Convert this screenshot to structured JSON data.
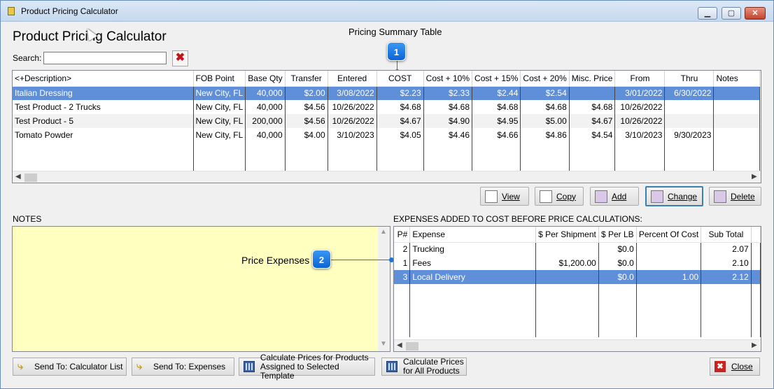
{
  "window": {
    "title": "Product Pricing Calculator",
    "heading": "Product Pricing Calculator",
    "minimize": "▁",
    "restore": "▢",
    "close": "✕"
  },
  "summary_label": "Pricing Summary Table",
  "callout1": "1",
  "callout2": "2",
  "search": {
    "label": "Search:",
    "value": "",
    "clear": "✖"
  },
  "pricing_table": {
    "columns": [
      "<+Description>",
      "FOB Point",
      "Base Qty",
      "Transfer",
      "Entered",
      "COST",
      "Cost + 10%",
      "Cost + 15%",
      "Cost + 20%",
      "Misc. Price",
      "From",
      "Thru",
      "Notes"
    ],
    "rows": [
      [
        "Italian Dressing",
        "New City, FL",
        "40,000",
        "$2.00",
        "3/08/2022",
        "$2.23",
        "$2.33",
        "$2.44",
        "$2.54",
        "",
        "3/01/2022",
        "6/30/2022",
        ""
      ],
      [
        "Test Product - 2 Trucks",
        "New City, FL",
        "40,000",
        "$4.56",
        "10/26/2022",
        "$4.68",
        "$4.68",
        "$4.68",
        "$4.68",
        "$4.68",
        "10/26/2022",
        "",
        ""
      ],
      [
        "Test Product - 5",
        "New City, FL",
        "200,000",
        "$4.56",
        "10/26/2022",
        "$4.67",
        "$4.90",
        "$4.95",
        "$5.00",
        "$4.67",
        "10/26/2022",
        "",
        ""
      ],
      [
        "Tomato Powder",
        "New City, FL",
        "40,000",
        "$4.00",
        "3/10/2023",
        "$4.05",
        "$4.46",
        "$4.66",
        "$4.86",
        "$4.54",
        "3/10/2023",
        "9/30/2023",
        ""
      ]
    ]
  },
  "actions": {
    "view": "View",
    "copy": "Copy",
    "add": "Add",
    "change": "Change",
    "delete": "Delete"
  },
  "notes_label": "NOTES",
  "price_expenses_label": "Price Expenses",
  "expenses_label": "EXPENSES ADDED TO COST BEFORE PRICE CALCULATIONS:",
  "expenses_table": {
    "columns": [
      "P#",
      "Expense",
      "$ Per Shipment",
      "$ Per LB",
      "Percent Of Cost",
      "Sub Total"
    ],
    "rows": [
      [
        "2",
        "Trucking",
        "",
        "$0.0",
        "",
        "2.07"
      ],
      [
        "1",
        "Fees",
        "$1,200.00",
        "$0.0",
        "",
        "2.10"
      ],
      [
        "3",
        "Local Delivery",
        "",
        "$0.0",
        "1.00",
        "2.12"
      ]
    ]
  },
  "bottom": {
    "send_calc": "Send To: Calculator List",
    "send_exp": "Send To: Expenses",
    "calc_template_1": "Calculate Prices for Products",
    "calc_template_2": "Assigned to Selected Template",
    "calc_all_1": "Calculate Prices",
    "calc_all_2": "for All Products",
    "close": "Close"
  },
  "colors": {
    "selection": "#5f8fd8",
    "notes_bg": "#ffffc0",
    "callout": "#1a74e0"
  }
}
